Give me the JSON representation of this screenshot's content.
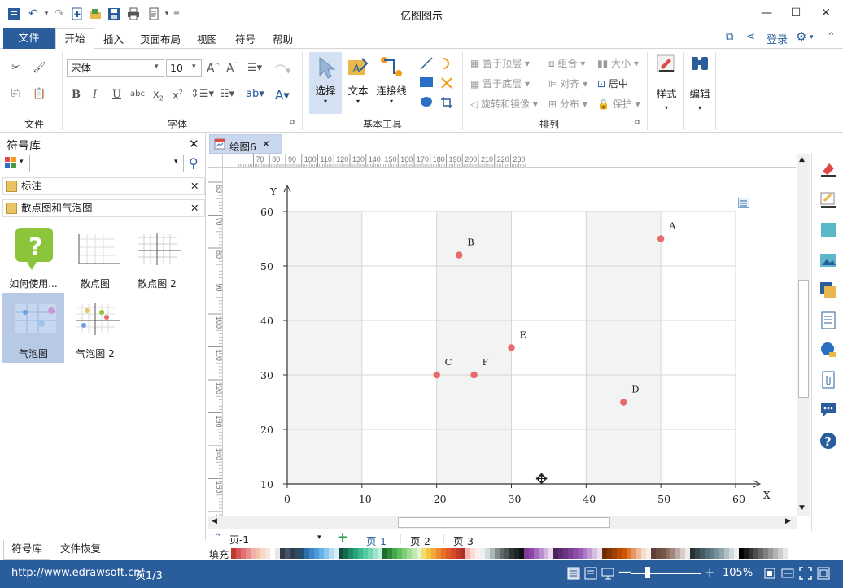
{
  "app": {
    "title": "亿图图示"
  },
  "menu": {
    "file": "文件",
    "tabs": [
      "开始",
      "插入",
      "页面布局",
      "视图",
      "符号",
      "帮助"
    ],
    "login": "登录"
  },
  "ribbon": {
    "font_name": "宋体",
    "font_size": "10",
    "groups": {
      "file": "文件",
      "font": "字体",
      "basic_tools": "基本工具",
      "arrange": "排列"
    },
    "tools": {
      "select": "选择",
      "text": "文本",
      "connector": "连接线"
    },
    "arrange": {
      "bring_front": "置于顶层",
      "send_back": "置于底层",
      "rotate_mirror": "旋转和镜像",
      "group": "组合",
      "align": "对齐",
      "distribute": "分布",
      "size": "大小",
      "center": "居中",
      "protect": "保护"
    },
    "style": "样式",
    "edit": "编辑"
  },
  "sidebar": {
    "title": "符号库",
    "libraries": [
      "标注",
      "散点图和气泡图"
    ],
    "shapes": [
      {
        "label": "如何使用..."
      },
      {
        "label": "散点图"
      },
      {
        "label": "散点图 2"
      },
      {
        "label": "气泡图"
      },
      {
        "label": "气泡图 2"
      }
    ],
    "bottom_tabs": [
      "符号库",
      "文件恢复"
    ]
  },
  "document": {
    "tab_title": "绘图6"
  },
  "rulers": {
    "top": [
      "70",
      "80",
      "90",
      "100",
      "110",
      "120",
      "130",
      "140",
      "150",
      "160",
      "170",
      "180",
      "190",
      "200",
      "210",
      "220",
      "230"
    ],
    "left": [
      "60",
      "70",
      "80",
      "90",
      "100",
      "110",
      "120",
      "130",
      "140",
      "150",
      "160"
    ]
  },
  "chart_data": {
    "type": "scatter",
    "xlabel": "X",
    "ylabel": "Y",
    "xlim": [
      0,
      60
    ],
    "ylim": [
      10,
      60
    ],
    "x_ticks": [
      "0",
      "10",
      "20",
      "30",
      "40",
      "50",
      "60"
    ],
    "y_ticks": [
      "10",
      "20",
      "30",
      "40",
      "50",
      "60"
    ],
    "points": [
      {
        "label": "A",
        "x": 50,
        "y": 55
      },
      {
        "label": "B",
        "x": 23,
        "y": 52
      },
      {
        "label": "C",
        "x": 20,
        "y": 30
      },
      {
        "label": "F",
        "x": 25,
        "y": 30
      },
      {
        "label": "E",
        "x": 30,
        "y": 35
      },
      {
        "label": "D",
        "x": 45,
        "y": 25
      }
    ],
    "point_color": "#e86a6a",
    "grid": true
  },
  "pages": {
    "tabs": [
      "页-1",
      "页-2",
      "页-3"
    ],
    "current": "页-1",
    "selector": "页-1"
  },
  "fill_label": "填充",
  "status": {
    "url": "http://www.edrawsoft.cn/",
    "page": "页1/3",
    "zoom": "105%"
  },
  "colors": {
    "accent": "#2a5d9c"
  }
}
